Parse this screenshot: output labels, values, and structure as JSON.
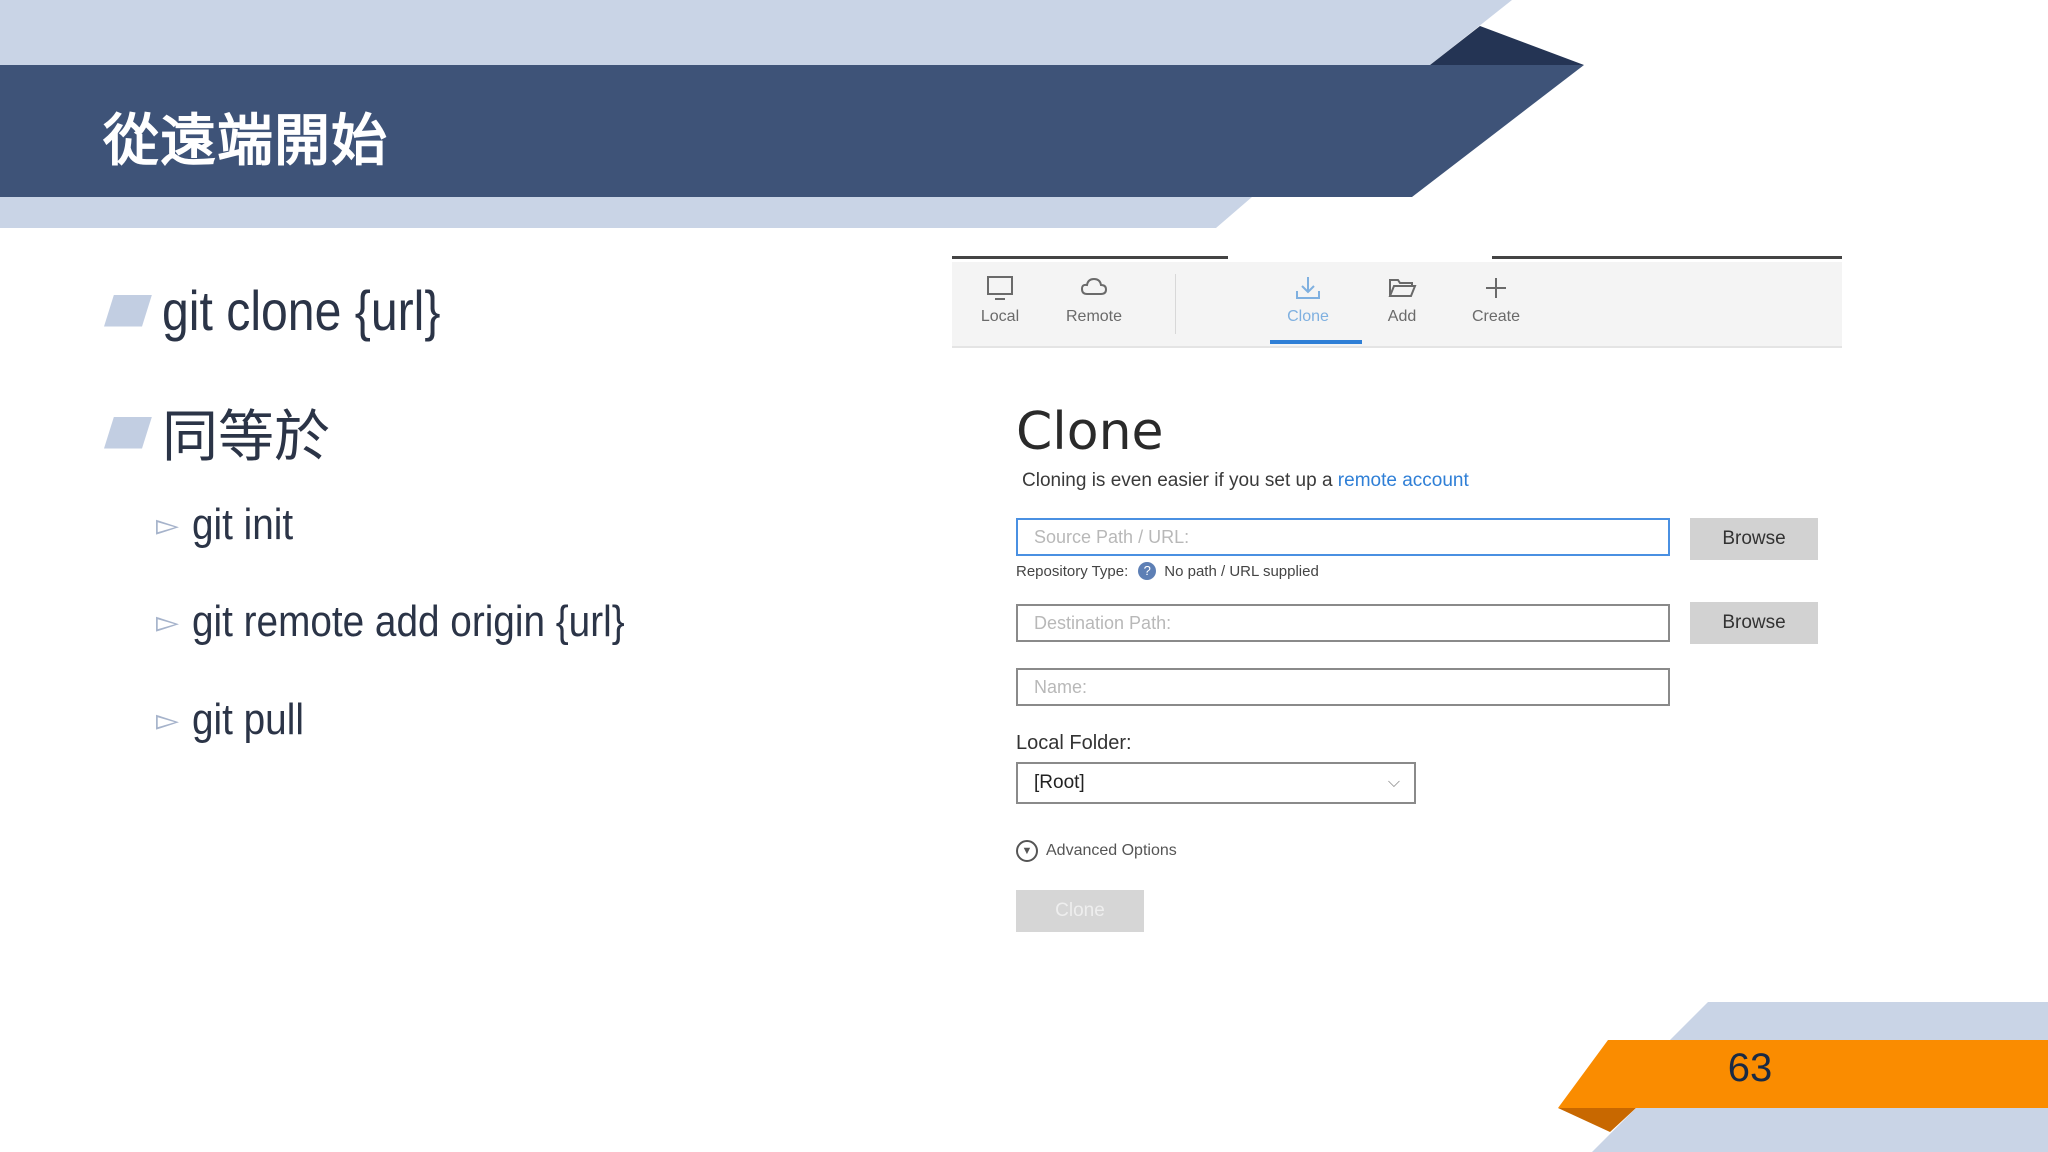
{
  "slide": {
    "title": "從遠端開始",
    "page_number": "63",
    "colors": {
      "header_dark": "#3e5378",
      "header_light": "#c9d4e6",
      "header_navy": "#243454",
      "accent_orange": "#fa8c00",
      "accent_orange_dark": "#c86800"
    }
  },
  "bullets": [
    {
      "text": "git clone {url}"
    },
    {
      "text": "同等於"
    }
  ],
  "sub_bullets": [
    {
      "text": "git init"
    },
    {
      "text": "git remote add origin {url}"
    },
    {
      "text": "git pull"
    }
  ],
  "app": {
    "toolbar": {
      "items": [
        {
          "label": "Local",
          "icon": "monitor-icon"
        },
        {
          "label": "Remote",
          "icon": "cloud-icon"
        },
        {
          "label": "Clone",
          "icon": "download-icon",
          "active": true
        },
        {
          "label": "Add",
          "icon": "folder-open-icon"
        },
        {
          "label": "Create",
          "icon": "plus-icon"
        }
      ]
    },
    "heading": "Clone",
    "subtitle_prefix": "Cloning is even easier if you set up a",
    "subtitle_link": "remote account",
    "source_placeholder": "Source Path / URL:",
    "repo_type_label": "Repository Type:",
    "repo_type_value": "No path / URL supplied",
    "destination_placeholder": "Destination Path:",
    "name_placeholder": "Name:",
    "browse_label": "Browse",
    "local_folder_label": "Local Folder:",
    "local_folder_value": "[Root]",
    "advanced_label": "Advanced Options",
    "clone_button_label": "Clone"
  }
}
